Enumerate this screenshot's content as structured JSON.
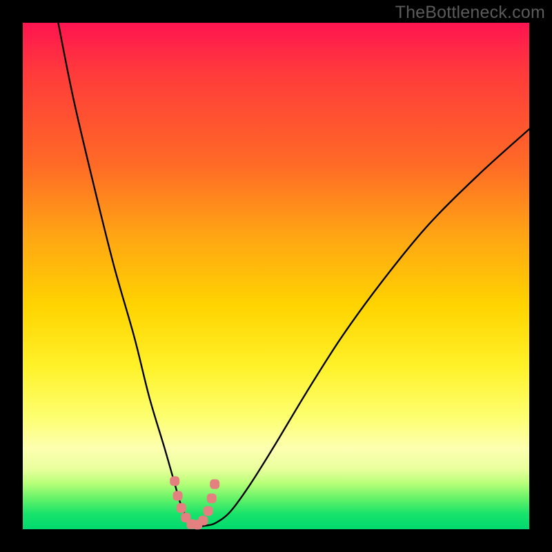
{
  "watermark": "TheBottleneck.com",
  "chart_data": {
    "type": "line",
    "title": "",
    "xlabel": "",
    "ylabel": "",
    "xlim": [
      0,
      100
    ],
    "ylim": [
      0,
      100
    ],
    "gradient_meaning": "background encodes value (red=high/bad, green=low/good)",
    "series": [
      {
        "name": "bottleneck-curve",
        "x": [
          7,
          10,
          14,
          18,
          22,
          25,
          28,
          30,
          31,
          32,
          33,
          34,
          35,
          36,
          38,
          41,
          45,
          50,
          56,
          63,
          71,
          80,
          90,
          100
        ],
        "values": [
          100,
          85,
          68,
          52,
          38,
          26,
          16,
          9,
          5.5,
          3,
          1.4,
          0.7,
          0.6,
          0.7,
          1.2,
          3.5,
          9,
          17,
          27,
          38,
          49,
          60,
          70,
          79
        ]
      }
    ],
    "markers": {
      "name": "optimum-band-dots",
      "color": "#e58080",
      "points_x": [
        30,
        30.6,
        31.3,
        32.2,
        33.3,
        34.5,
        35.6,
        36.6,
        37.3,
        37.9
      ],
      "points_y": [
        9.5,
        6.6,
        4.2,
        2.3,
        1.0,
        0.9,
        1.7,
        3.6,
        6.1,
        8.9
      ]
    }
  }
}
